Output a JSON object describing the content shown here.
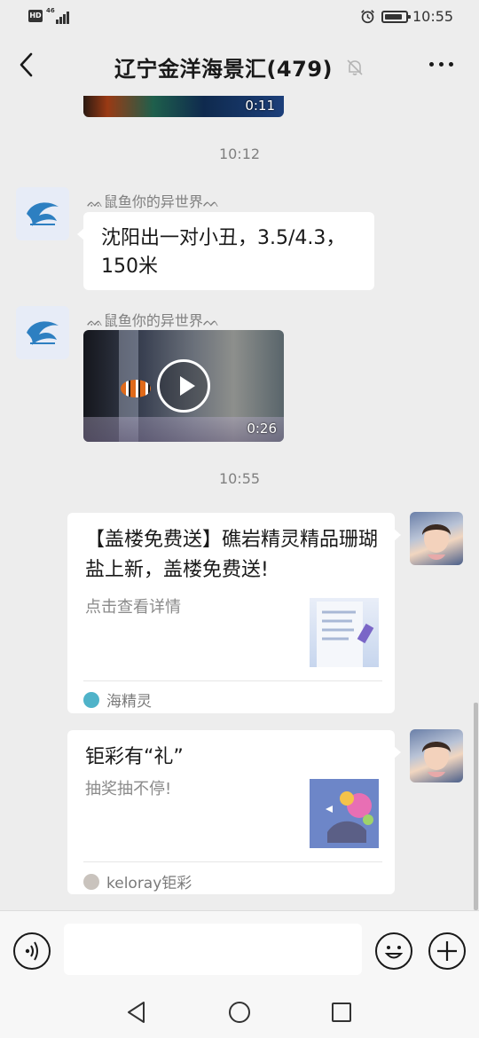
{
  "status_bar": {
    "hd_badge": "HD",
    "network": "46",
    "time": "10:55"
  },
  "header": {
    "title": "辽宁金洋海景汇(479)"
  },
  "messages": {
    "video_top_duration": "0:11",
    "timestamp_1": "10:12",
    "sender_1": "ᨐ鼠鱼你的异世界ᨓ",
    "text_1": "沈阳出一对小丑，3.5/4.3，150米",
    "sender_2": "ᨐ鼠鱼你的异世界ᨓ",
    "video_duration": "0:26",
    "timestamp_2": "10:55",
    "card_1": {
      "title": "【盖楼免费送】礁岩精灵精品珊瑚盐上新，盖楼免费送!",
      "desc": "点击查看详情",
      "source": "海精灵"
    },
    "card_2": {
      "title": "钜彩有“礼”",
      "desc": "抽奖抽不停!",
      "source": "keloray钜彩"
    }
  },
  "input": {
    "placeholder": ""
  },
  "icons": {
    "back": "chevron-left-icon",
    "mute": "bell-off-icon",
    "more": "more-horizontal-icon",
    "voice": "voice-icon",
    "emoji": "emoji-icon",
    "plus": "plus-icon"
  },
  "colors": {
    "background": "#ededed",
    "bubble": "#ffffff",
    "text": "#191919",
    "muted_text": "#808080"
  }
}
